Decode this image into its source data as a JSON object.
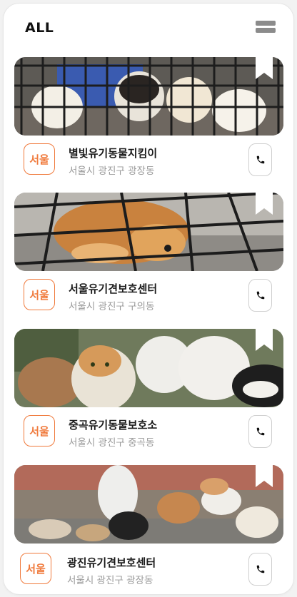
{
  "header": {
    "title": "ALL",
    "menu_icon": "hamburger-menu-icon"
  },
  "colors": {
    "accent": "#f07a3c",
    "badge_border": "#f07a3c",
    "call_border": "#cfcfcf"
  },
  "shelters": [
    {
      "region": "서울",
      "name": "별빛유기동물지킴이",
      "address": "서울시 광진구 광장동",
      "photo": "puppies-in-cage",
      "call_icon": "phone-icon",
      "bookmark_icon": "bookmark-icon"
    },
    {
      "region": "서울",
      "name": "서울유기견보호센터",
      "address": "서울시 광진구 구의동",
      "photo": "puppy-behind-bars",
      "call_icon": "phone-icon",
      "bookmark_icon": "bookmark-icon"
    },
    {
      "region": "서울",
      "name": "중곡유기동물보호소",
      "address": "서울시 광진구 중곡동",
      "photo": "cats-and-dogs",
      "call_icon": "phone-icon",
      "bookmark_icon": "bookmark-icon"
    },
    {
      "region": "서울",
      "name": "광진유기견보호센터",
      "address": "서울시 광진구 광장동",
      "photo": "shelter-dogs-group",
      "call_icon": "phone-icon",
      "bookmark_icon": "bookmark-icon"
    }
  ]
}
